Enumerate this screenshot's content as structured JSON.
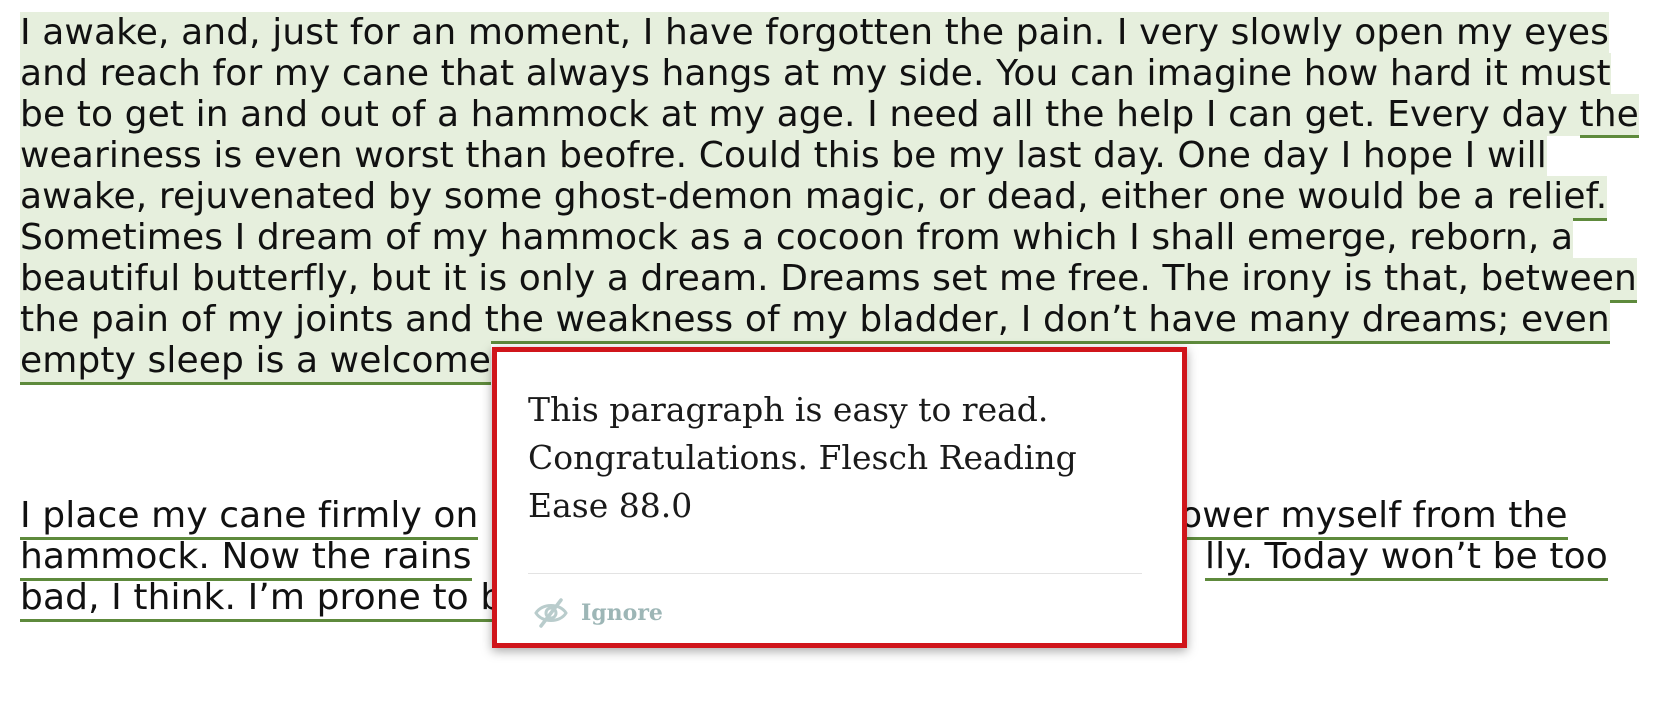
{
  "paragraph1": {
    "lines": [
      "I awake, and, just for an moment, I have forgotten the pain. I very slowly open my eyes",
      "and reach for my cane that always hangs at my side. You can imagine how hard it must",
      "be to get in and out of a hammock at my age. I need all the help I can get. Every day ",
      "the",
      "weariness is even worst than beofre. Could this be my last day. One day I hope I will",
      "awake, rejuvenated by some ghost-demon magic, or dead, either one would be a relief.",
      "Sometimes I dream of my hammock as a cocoon from which I shall emerge, reborn, a",
      "beautiful butterfly, but it is only a dream. Dreams set me free. The irony is that, between",
      "the pain of my joints and the weakness of my bladder, I don’t have many dreams; even",
      "empty sleep is a welcome"
    ]
  },
  "paragraph2": {
    "lines": [
      "I place my cane firmly on",
      "lower myself from the",
      "hammock. Now the rains",
      "lly. Today won’t be too",
      "bad, I think. I’m prone to be over-optimistic."
    ]
  },
  "popup": {
    "message": "This paragraph is easy to read. Congratulations. Flesch Reading Ease 88.0",
    "ignore_label": "Ignore",
    "ignore_icon": "eye-slash-icon",
    "border_color": "#d0151b"
  },
  "colors": {
    "highlight": "#e6efdd",
    "underline": "#5e8a3c"
  }
}
